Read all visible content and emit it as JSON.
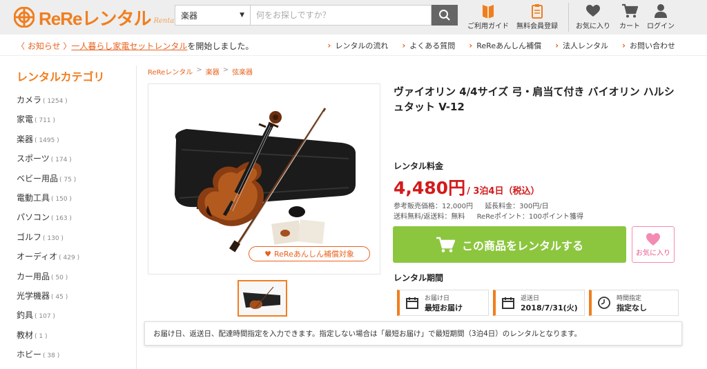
{
  "header": {
    "logo_text": "ReReレンタル",
    "logo_sub": "Rental",
    "category_select": "楽器",
    "search_placeholder": "何をお探しですか？",
    "nav": [
      {
        "label": "ご利用ガイド",
        "icon": "guide-icon"
      },
      {
        "label": "無料会員登録",
        "icon": "register-icon"
      },
      {
        "label": "お気に入り",
        "icon": "heart-icon"
      },
      {
        "label": "カート",
        "icon": "cart-icon"
      },
      {
        "label": "ログイン",
        "icon": "user-icon"
      }
    ]
  },
  "notice": {
    "label": "〈 お知らせ 〉",
    "link": "一人暮らし家電セットレンタル",
    "text": "を開始しました。"
  },
  "topnav": [
    "レンタルの流れ",
    "よくある質問",
    "ReReあんしん補償",
    "法人レンタル",
    "お問い合わせ"
  ],
  "sidebar": {
    "title": "レンタルカテゴリ",
    "items": [
      {
        "label": "カメラ",
        "count": "( 1254 )"
      },
      {
        "label": "家電",
        "count": "( 711 )"
      },
      {
        "label": "楽器",
        "count": "( 1495 )"
      },
      {
        "label": "スポーツ",
        "count": "( 174 )"
      },
      {
        "label": "ベビー用品",
        "count": "( 75 )"
      },
      {
        "label": "電動工具",
        "count": "( 150 )"
      },
      {
        "label": "パソコン",
        "count": "( 163 )"
      },
      {
        "label": "ゴルフ",
        "count": "( 130 )"
      },
      {
        "label": "オーディオ",
        "count": "( 429 )"
      },
      {
        "label": "カー用品",
        "count": "( 50 )"
      },
      {
        "label": "光学機器",
        "count": "( 45 )"
      },
      {
        "label": "釣具",
        "count": "( 107 )"
      },
      {
        "label": "教材",
        "count": "( 1 )"
      },
      {
        "label": "ホビー",
        "count": "( 38 )"
      }
    ]
  },
  "breadcrumb": [
    "ReReレンタル",
    "楽器",
    "弦楽器"
  ],
  "product": {
    "title": "ヴァイオリン 4/4サイズ 弓・肩当て付き バイオリン ハルシュタット V-12",
    "guarantee_badge": "ReReあんしん補償対象",
    "rental_fee_label": "レンタル料金",
    "price": "4,480円",
    "price_period": "/ 3泊4日（税込）",
    "meta1": [
      "参考販売価格：12,000円",
      "延長料金：300円/日"
    ],
    "meta2": [
      "送料無料/返送料：無料",
      "ReReポイント：100ポイント獲得"
    ],
    "rent_button": "この商品をレンタルする",
    "fav_button": "お気に入り",
    "period_label": "レンタル期間",
    "period": [
      {
        "small": "お届け日",
        "big": "最短お届け",
        "icon": "calendar-icon"
      },
      {
        "small": "返送日",
        "big": "2018/7/31(火)",
        "icon": "calendar-icon"
      },
      {
        "small": "時間指定",
        "big": "指定なし",
        "icon": "clock-icon"
      }
    ],
    "tooltip": "お届け日、返送日、配達時間指定を入力できます。指定しない場合は「最短お届け」で最短期間（3泊4日）のレンタルとなります。"
  },
  "colors": {
    "accent": "#f07e1e",
    "price": "#d31a1a",
    "rent_button": "#8cc63f",
    "fav": "#e8578e"
  }
}
